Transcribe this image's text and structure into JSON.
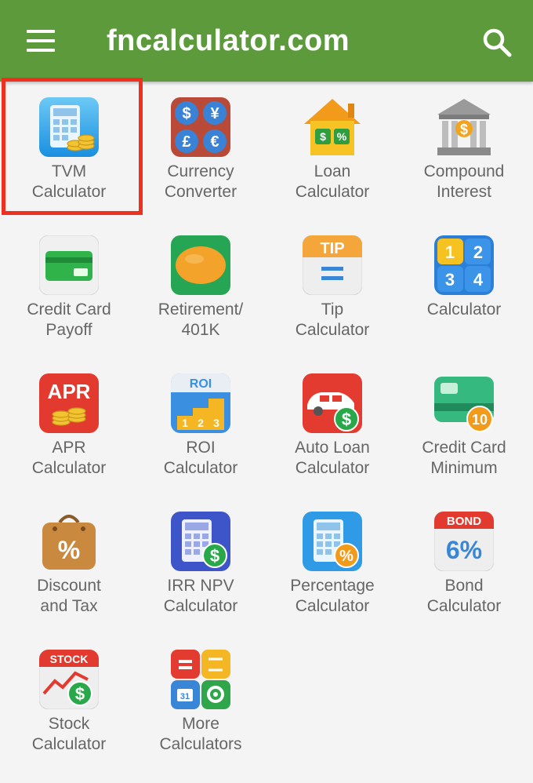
{
  "appbar": {
    "title": "fncalculator.com",
    "menu_icon": "hamburger-menu-icon",
    "search_icon": "search-icon",
    "color": "#5c9a3c"
  },
  "highlight_color": "#f0301e",
  "tiles": [
    {
      "line1": "TVM",
      "line2": "Calculator",
      "icon": "tvm-calculator-icon"
    },
    {
      "line1": "Currency",
      "line2": "Converter",
      "icon": "currency-converter-icon"
    },
    {
      "line1": "Loan",
      "line2": "Calculator",
      "icon": "loan-house-icon"
    },
    {
      "line1": "Compound",
      "line2": "Interest",
      "icon": "bank-building-icon"
    },
    {
      "line1": "Credit Card",
      "line2": "Payoff",
      "icon": "credit-card-icon"
    },
    {
      "line1": "Retirement/",
      "line2": "401K",
      "icon": "retirement-nest-egg-icon"
    },
    {
      "line1": "Tip",
      "line2": "Calculator",
      "icon": "tip-calculator-icon"
    },
    {
      "line1": "Calculator",
      "line2": "",
      "icon": "basic-calculator-icon"
    },
    {
      "line1": "APR",
      "line2": "Calculator",
      "icon": "apr-calculator-icon"
    },
    {
      "line1": "ROI",
      "line2": "Calculator",
      "icon": "roi-chart-icon"
    },
    {
      "line1": "Auto Loan",
      "line2": "Calculator",
      "icon": "car-loan-icon"
    },
    {
      "line1": "Credit Card",
      "line2": "Minimum",
      "icon": "credit-card-minimum-icon"
    },
    {
      "line1": "Discount",
      "line2": "and Tax",
      "icon": "discount-bag-icon"
    },
    {
      "line1": "IRR NPV",
      "line2": "Calculator",
      "icon": "irr-npv-calculator-icon"
    },
    {
      "line1": "Percentage",
      "line2": "Calculator",
      "icon": "percentage-calculator-icon"
    },
    {
      "line1": "Bond",
      "line2": "Calculator",
      "icon": "bond-calendar-icon"
    },
    {
      "line1": "Stock",
      "line2": "Calculator",
      "icon": "stock-chart-icon"
    },
    {
      "line1": "More",
      "line2": "Calculators",
      "icon": "more-calculators-icon"
    }
  ],
  "icon_text": {
    "currency": [
      "$",
      "¥",
      "£",
      "€"
    ],
    "loan": [
      "$",
      "%"
    ],
    "compound": "$",
    "tip": "TIP",
    "calc": [
      "1",
      "2",
      "3",
      "4"
    ],
    "apr": "APR",
    "roi": "ROI",
    "roi_steps": [
      "1",
      "2",
      "3"
    ],
    "auto": "$",
    "ccmin": "10",
    "discount": "%",
    "irr": "$",
    "pct": "%",
    "bond_top": "BOND",
    "bond_main": "6%",
    "stock_top": "STOCK",
    "stock_coin": "$",
    "more_day": "31"
  }
}
